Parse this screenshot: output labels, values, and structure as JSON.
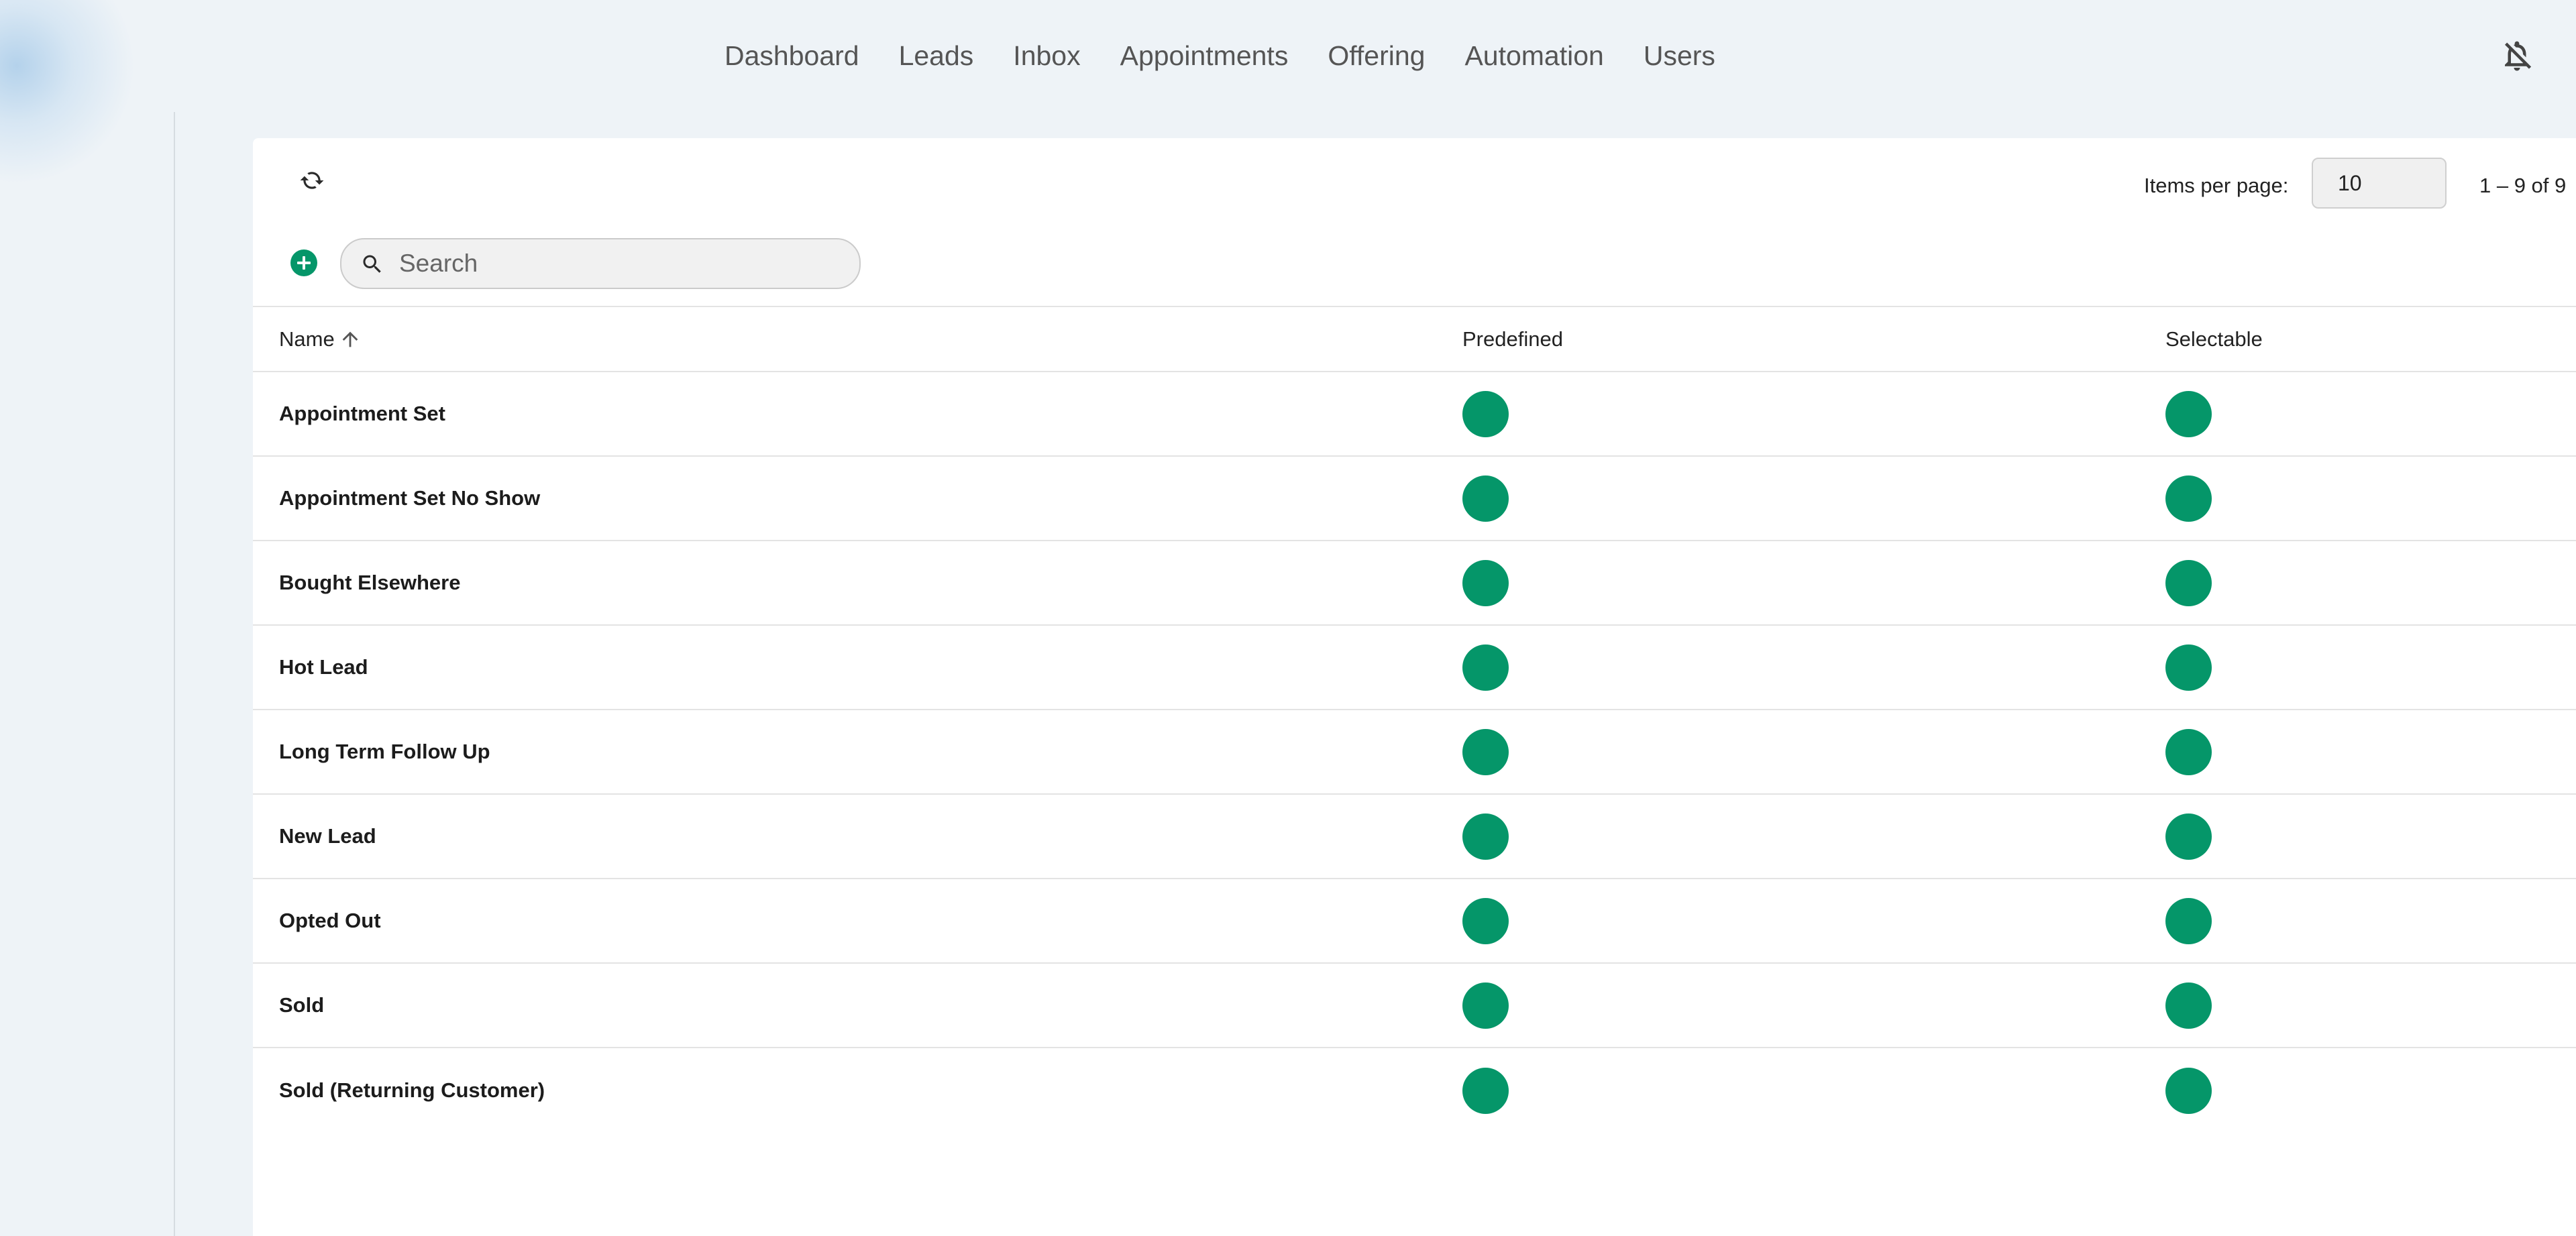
{
  "nav": {
    "items": [
      {
        "label": "Dashboard"
      },
      {
        "label": "Leads"
      },
      {
        "label": "Inbox"
      },
      {
        "label": "Appointments"
      },
      {
        "label": "Offering"
      },
      {
        "label": "Automation"
      },
      {
        "label": "Users"
      }
    ]
  },
  "header": {
    "notifications_icon": "notifications-off-icon"
  },
  "toolbar": {
    "refresh_icon": "refresh-icon",
    "add_icon": "add-circle-icon",
    "search": {
      "icon": "search-icon",
      "placeholder": "Search",
      "value": ""
    },
    "pagination": {
      "items_per_page_label": "Items per page:",
      "items_per_page": "10",
      "range_label": "1 – 9 of 9"
    }
  },
  "table": {
    "columns": [
      {
        "label": "Name",
        "sort": "ascending",
        "sort_icon": "arrow-up-icon"
      },
      {
        "label": "Predefined"
      },
      {
        "label": "Selectable"
      }
    ],
    "rows": [
      {
        "name": "Appointment Set",
        "predefined": true,
        "selectable": true
      },
      {
        "name": "Appointment Set No Show",
        "predefined": true,
        "selectable": true
      },
      {
        "name": "Bought Elsewhere",
        "predefined": true,
        "selectable": true
      },
      {
        "name": "Hot Lead",
        "predefined": true,
        "selectable": true
      },
      {
        "name": "Long Term Follow Up",
        "predefined": true,
        "selectable": true
      },
      {
        "name": "New Lead",
        "predefined": true,
        "selectable": true
      },
      {
        "name": "Opted Out",
        "predefined": true,
        "selectable": true
      },
      {
        "name": "Sold",
        "predefined": true,
        "selectable": true
      },
      {
        "name": "Sold (Returning Customer)",
        "predefined": true,
        "selectable": true
      }
    ]
  },
  "colors": {
    "accent": "#059669",
    "page_background": "#eef3f7",
    "card_background": "#ffffff",
    "nav_text": "#555555"
  }
}
